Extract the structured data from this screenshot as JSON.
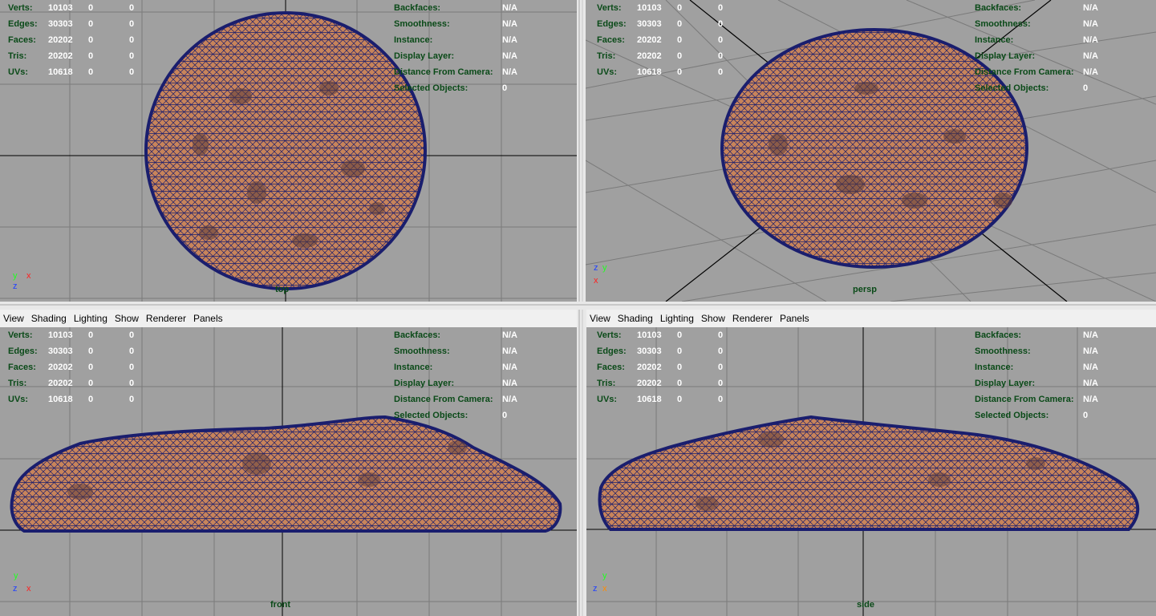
{
  "menus": [
    "View",
    "Shading",
    "Lighting",
    "Show",
    "Renderer",
    "Panels"
  ],
  "stats": [
    {
      "label": "Verts:",
      "v1": "10103",
      "v2": "0",
      "v3": "0"
    },
    {
      "label": "Edges:",
      "v1": "30303",
      "v2": "0",
      "v3": "0"
    },
    {
      "label": "Faces:",
      "v1": "20202",
      "v2": "0",
      "v3": "0"
    },
    {
      "label": "Tris:",
      "v1": "20202",
      "v2": "0",
      "v3": "0"
    },
    {
      "label": "UVs:",
      "v1": "10618",
      "v2": "0",
      "v3": "0"
    }
  ],
  "info": [
    {
      "label": "Backfaces:",
      "value": "N/A"
    },
    {
      "label": "Smoothness:",
      "value": "N/A"
    },
    {
      "label": "Instance:",
      "value": "N/A"
    },
    {
      "label": "Display Layer:",
      "value": "N/A"
    },
    {
      "label": "Distance From Camera:",
      "value": "N/A"
    },
    {
      "label": "Selected Objects:",
      "value": "0"
    }
  ],
  "panes": {
    "top": {
      "camera": "top"
    },
    "persp": {
      "camera": "persp"
    },
    "front": {
      "camera": "front"
    },
    "side": {
      "camera": "side"
    }
  },
  "colors": {
    "viewport_bg": "#a0a0a0",
    "grid": "#7a7a7a",
    "axis_line": "#000000",
    "mesh_fill": "#c8845a",
    "wire": "#1a1e6e",
    "hud_label": "#0a4a18",
    "axis_x": "#ff2020",
    "axis_y": "#20ff20",
    "axis_z": "#2040ff"
  }
}
